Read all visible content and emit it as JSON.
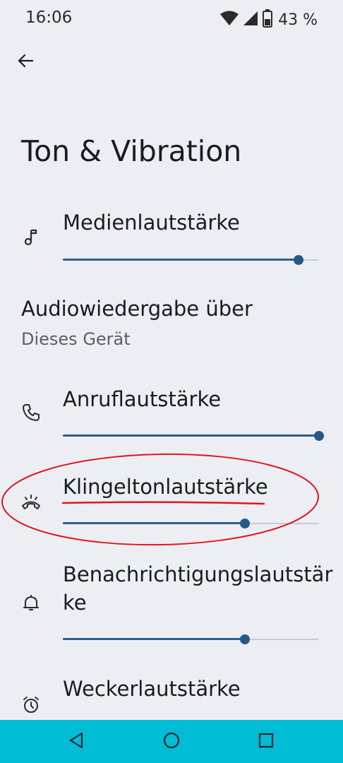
{
  "status_bar": {
    "time": "16:06",
    "battery_percent": "43 %",
    "icons": [
      "wifi-icon",
      "cell-signal-icon",
      "battery-icon"
    ]
  },
  "header": {
    "back_icon": "arrow-left-icon",
    "title": "Ton & Vibration"
  },
  "settings": {
    "media": {
      "label": "Medienlautstärke",
      "icon": "music-note-icon",
      "level": 0.92
    },
    "audio_output": {
      "title": "Audiowiedergabe über",
      "subtitle": "Dieses Gerät"
    },
    "call": {
      "label": "Anruflautstärke",
      "icon": "phone-icon",
      "level": 1.0
    },
    "ring": {
      "label": "Klingeltonlautstärke",
      "icon": "ring-volume-icon",
      "level": 0.71
    },
    "notification": {
      "label_line1": "Benachrichtigungslautstär",
      "label_line2": "ke",
      "icon": "bell-icon",
      "level": 0.71
    },
    "alarm": {
      "label": "Weckerlautstärke",
      "icon": "alarm-clock-icon"
    }
  },
  "annotation": {
    "color": "#e0161b",
    "shape": "ellipse with underline",
    "target": "Klingeltonlautstärke"
  },
  "nav_bar": {
    "color": "#00bcd4",
    "buttons": [
      "back-triangle-icon",
      "home-circle-icon",
      "recents-square-icon"
    ]
  },
  "colors": {
    "background": "#eceef4",
    "slider_active": "#2c5f8a",
    "slider_inactive": "#c8ccd4"
  }
}
